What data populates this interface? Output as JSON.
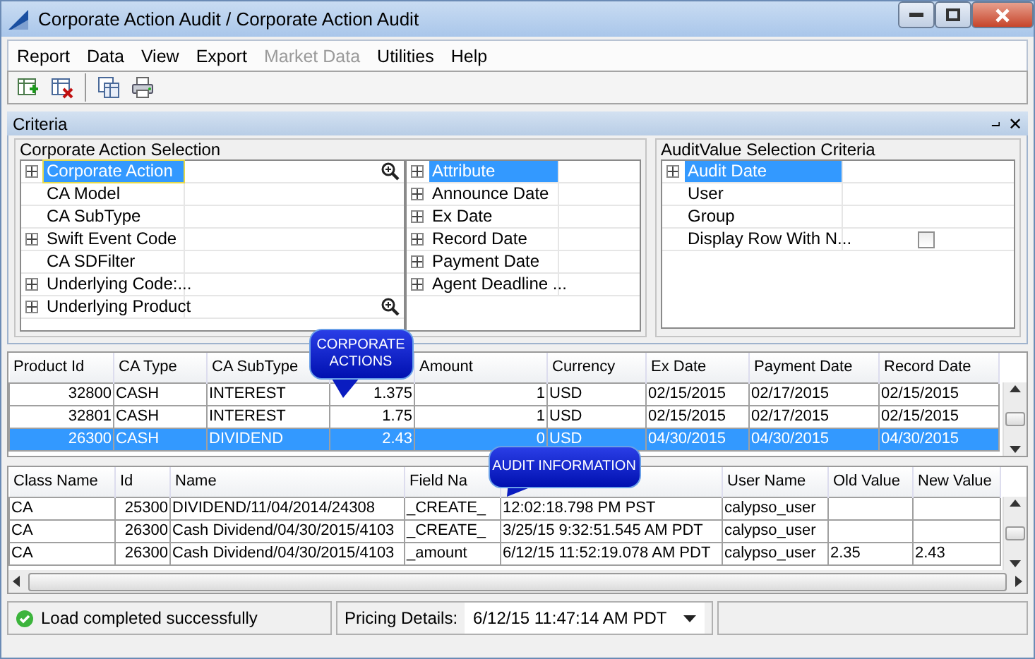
{
  "window": {
    "title": "Corporate Action Audit / Corporate Action Audit"
  },
  "menu": [
    {
      "label": "Report",
      "disabled": false
    },
    {
      "label": "Data",
      "disabled": false
    },
    {
      "label": "View",
      "disabled": false
    },
    {
      "label": "Export",
      "disabled": false
    },
    {
      "label": "Market Data",
      "disabled": true
    },
    {
      "label": "Utilities",
      "disabled": false
    },
    {
      "label": "Help",
      "disabled": false
    }
  ],
  "criteria": {
    "title": "Criteria",
    "pin": "⨼",
    "close": "✕",
    "ca_selection": {
      "title": "Corporate Action Selection",
      "left_items": [
        {
          "label": "Corporate Action",
          "expandable": true,
          "selected": true,
          "lookup": true
        },
        {
          "label": "CA Model",
          "expandable": false,
          "selected": false,
          "lookup": false
        },
        {
          "label": "CA SubType",
          "expandable": false,
          "selected": false,
          "lookup": false
        },
        {
          "label": "Swift Event Code",
          "expandable": true,
          "selected": false,
          "lookup": false
        },
        {
          "label": "CA SDFilter",
          "expandable": false,
          "selected": false,
          "lookup": false
        },
        {
          "label": "Underlying Code:...",
          "expandable": true,
          "selected": false,
          "lookup": false
        },
        {
          "label": "Underlying Product",
          "expandable": true,
          "selected": false,
          "lookup": true
        }
      ],
      "right_items": [
        {
          "label": "Attribute",
          "expandable": true,
          "selected": true
        },
        {
          "label": "Announce Date",
          "expandable": true,
          "selected": false
        },
        {
          "label": "Ex Date",
          "expandable": true,
          "selected": false
        },
        {
          "label": "Record Date",
          "expandable": true,
          "selected": false
        },
        {
          "label": "Payment Date",
          "expandable": true,
          "selected": false
        },
        {
          "label": "Agent Deadline ...",
          "expandable": true,
          "selected": false
        }
      ]
    },
    "audit_selection": {
      "title": "AuditValue Selection Criteria",
      "items": [
        {
          "label": "Audit Date",
          "expandable": true,
          "selected": true,
          "kind": "text"
        },
        {
          "label": "User",
          "expandable": false,
          "selected": false,
          "kind": "text"
        },
        {
          "label": "Group",
          "expandable": false,
          "selected": false,
          "kind": "text"
        },
        {
          "label": "Display Row With N...",
          "expandable": false,
          "selected": false,
          "kind": "checkbox",
          "checked": false
        }
      ]
    }
  },
  "products_table": {
    "columns": [
      "Product Id",
      "CA Type",
      "CA SubType",
      "",
      "Amount",
      "Currency",
      "Ex Date",
      "Payment Date",
      "Record Date"
    ],
    "rows": [
      {
        "cells": [
          "32800",
          "CASH",
          "INTEREST",
          "1.375",
          "1",
          "USD",
          "02/15/2015",
          "02/17/2015",
          "02/15/2015"
        ],
        "selected": false
      },
      {
        "cells": [
          "32801",
          "CASH",
          "INTEREST",
          "1.75",
          "1",
          "USD",
          "02/15/2015",
          "02/17/2015",
          "02/15/2015"
        ],
        "selected": false
      },
      {
        "cells": [
          "26300",
          "CASH",
          "DIVIDEND",
          "2.43",
          "0",
          "USD",
          "04/30/2015",
          "04/30/2015",
          "04/30/2015"
        ],
        "selected": true
      }
    ]
  },
  "audit_table": {
    "columns": [
      "Class Name",
      "Id",
      "Name",
      "Field Na",
      "",
      "User Name",
      "Old Value",
      "New Value"
    ],
    "rows": [
      {
        "cells": [
          "CA",
          "25300",
          "DIVIDEND/11/04/2014/24308",
          "_CREATE_",
          "12:02:18.798 PM PST",
          "calypso_user",
          "",
          ""
        ],
        "selected": false
      },
      {
        "cells": [
          "CA",
          "26300",
          "Cash Dividend/04/30/2015/4103",
          "_CREATE_",
          "3/25/15 9:32:51.545 AM PDT",
          "calypso_user",
          "",
          ""
        ],
        "selected": false
      },
      {
        "cells": [
          "CA",
          "26300",
          "Cash Dividend/04/30/2015/4103",
          "_amount",
          "6/12/15 11:52:19.078 AM PDT",
          "calypso_user",
          "2.35",
          "2.43"
        ],
        "selected": false
      }
    ]
  },
  "callouts": [
    {
      "text": "CORPORATE ACTIONS"
    },
    {
      "text": "AUDIT INFORMATION"
    }
  ],
  "status_bar": {
    "message": "Load completed successfully",
    "pricing_label": "Pricing Details:",
    "pricing_value": "6/12/15 11:47:14 AM PDT"
  }
}
